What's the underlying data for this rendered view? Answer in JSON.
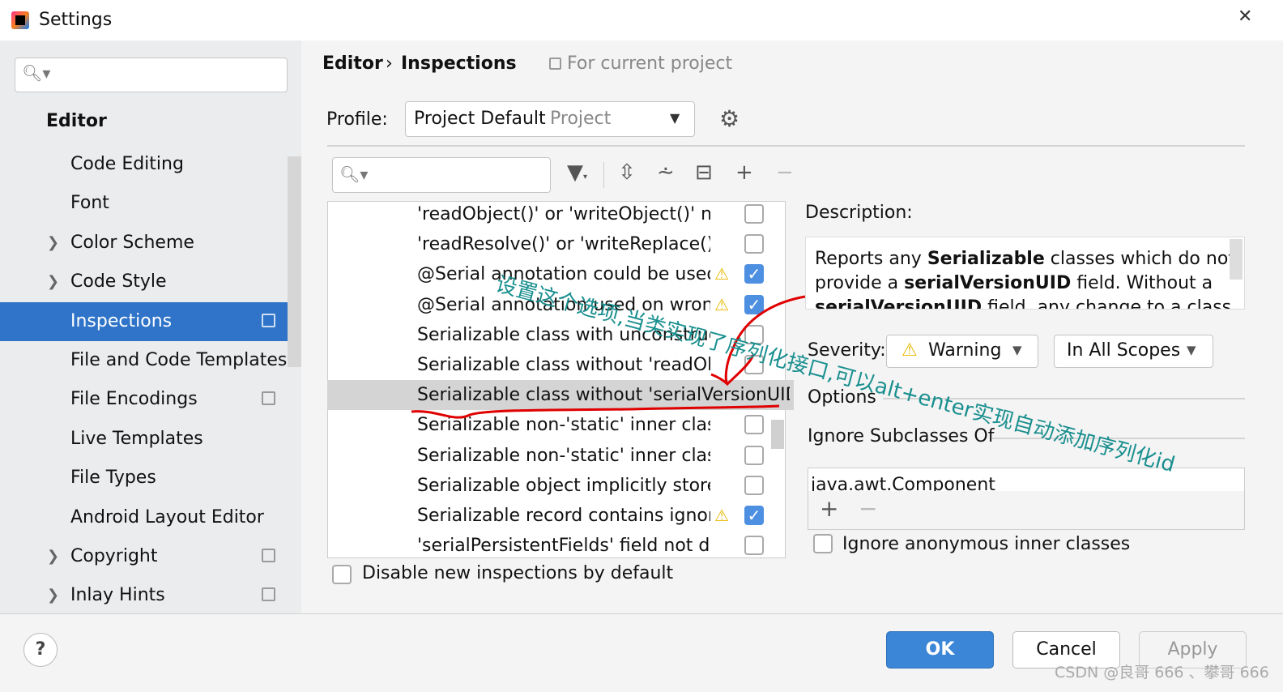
{
  "window": {
    "title": "Settings"
  },
  "sidebar": {
    "section": "Editor",
    "items": [
      {
        "label": "Code Editing",
        "expandable": false,
        "project": false
      },
      {
        "label": "Font",
        "expandable": false,
        "project": false
      },
      {
        "label": "Color Scheme",
        "expandable": true,
        "project": false
      },
      {
        "label": "Code Style",
        "expandable": true,
        "project": false
      },
      {
        "label": "Inspections",
        "expandable": false,
        "project": true,
        "selected": true
      },
      {
        "label": "File and Code Templates",
        "expandable": false,
        "project": false
      },
      {
        "label": "File Encodings",
        "expandable": false,
        "project": true
      },
      {
        "label": "Live Templates",
        "expandable": false,
        "project": false
      },
      {
        "label": "File Types",
        "expandable": false,
        "project": false
      },
      {
        "label": "Android Layout Editor",
        "expandable": false,
        "project": false
      },
      {
        "label": "Copyright",
        "expandable": true,
        "project": true
      },
      {
        "label": "Inlay Hints",
        "expandable": true,
        "project": true
      }
    ]
  },
  "breadcrumb": {
    "parent": "Editor",
    "sep": "›",
    "current": "Inspections",
    "scope": "For current project"
  },
  "profile": {
    "label": "Profile:",
    "value": "Project Default",
    "hint": "Project"
  },
  "inspections": [
    {
      "text": "'readObject()' or 'writeObject()' not",
      "warn": false,
      "checked": false
    },
    {
      "text": "'readResolve()' or 'writeReplace()' r",
      "warn": false,
      "checked": false
    },
    {
      "text": "@Serial annotation could be used",
      "warn": true,
      "checked": true
    },
    {
      "text": "@Serial annotation used on wrong",
      "warn": true,
      "checked": true
    },
    {
      "text": "Serializable class with unconstructa",
      "warn": false,
      "checked": false
    },
    {
      "text": "Serializable class without 'readObje",
      "warn": false,
      "checked": false
    },
    {
      "text": "Serializable class without 'serialVersionUID'",
      "warn": false,
      "checked": false,
      "selected": true
    },
    {
      "text": "Serializable non-'static' inner class",
      "warn": false,
      "checked": false
    },
    {
      "text": "Serializable non-'static' inner class",
      "warn": false,
      "checked": false
    },
    {
      "text": "Serializable object implicitly stores",
      "warn": false,
      "checked": false
    },
    {
      "text": "Serializable record contains ignore",
      "warn": true,
      "checked": true
    },
    {
      "text": "'serialPersistentFields' field not dec",
      "warn": false,
      "checked": false
    }
  ],
  "disable_new": "Disable new inspections by default",
  "description": {
    "label": "Description:",
    "line1_a": "Reports any ",
    "line1_b": "Serializable",
    "line1_c": " classes which do not",
    "line2_a": "provide a ",
    "line2_b": "serialVersionUID",
    "line2_c": " field. Without a",
    "line3_b": "serialVersionUID",
    "line3_c": " field, any change to a class"
  },
  "severity": {
    "label": "Severity:",
    "value": "Warning",
    "scope": "In All Scopes"
  },
  "options": {
    "label": "Options",
    "ignore_sub": "Ignore Subclasses Of",
    "class_value": "java.awt.Component",
    "ignore_anon": "Ignore anonymous inner classes"
  },
  "buttons": {
    "ok": "OK",
    "cancel": "Cancel",
    "apply": "Apply",
    "help": "?"
  },
  "annotation": "设置这个选项,当类实现了序列化接口,可以alt+enter实现自动添加序列化id",
  "watermark": "CSDN @良哥 666 、攀哥 666",
  "colors": {
    "accent": "#2f74c8",
    "warning": "#e8b900",
    "annotation": "#1a8f8f",
    "ink": "#e00000"
  }
}
